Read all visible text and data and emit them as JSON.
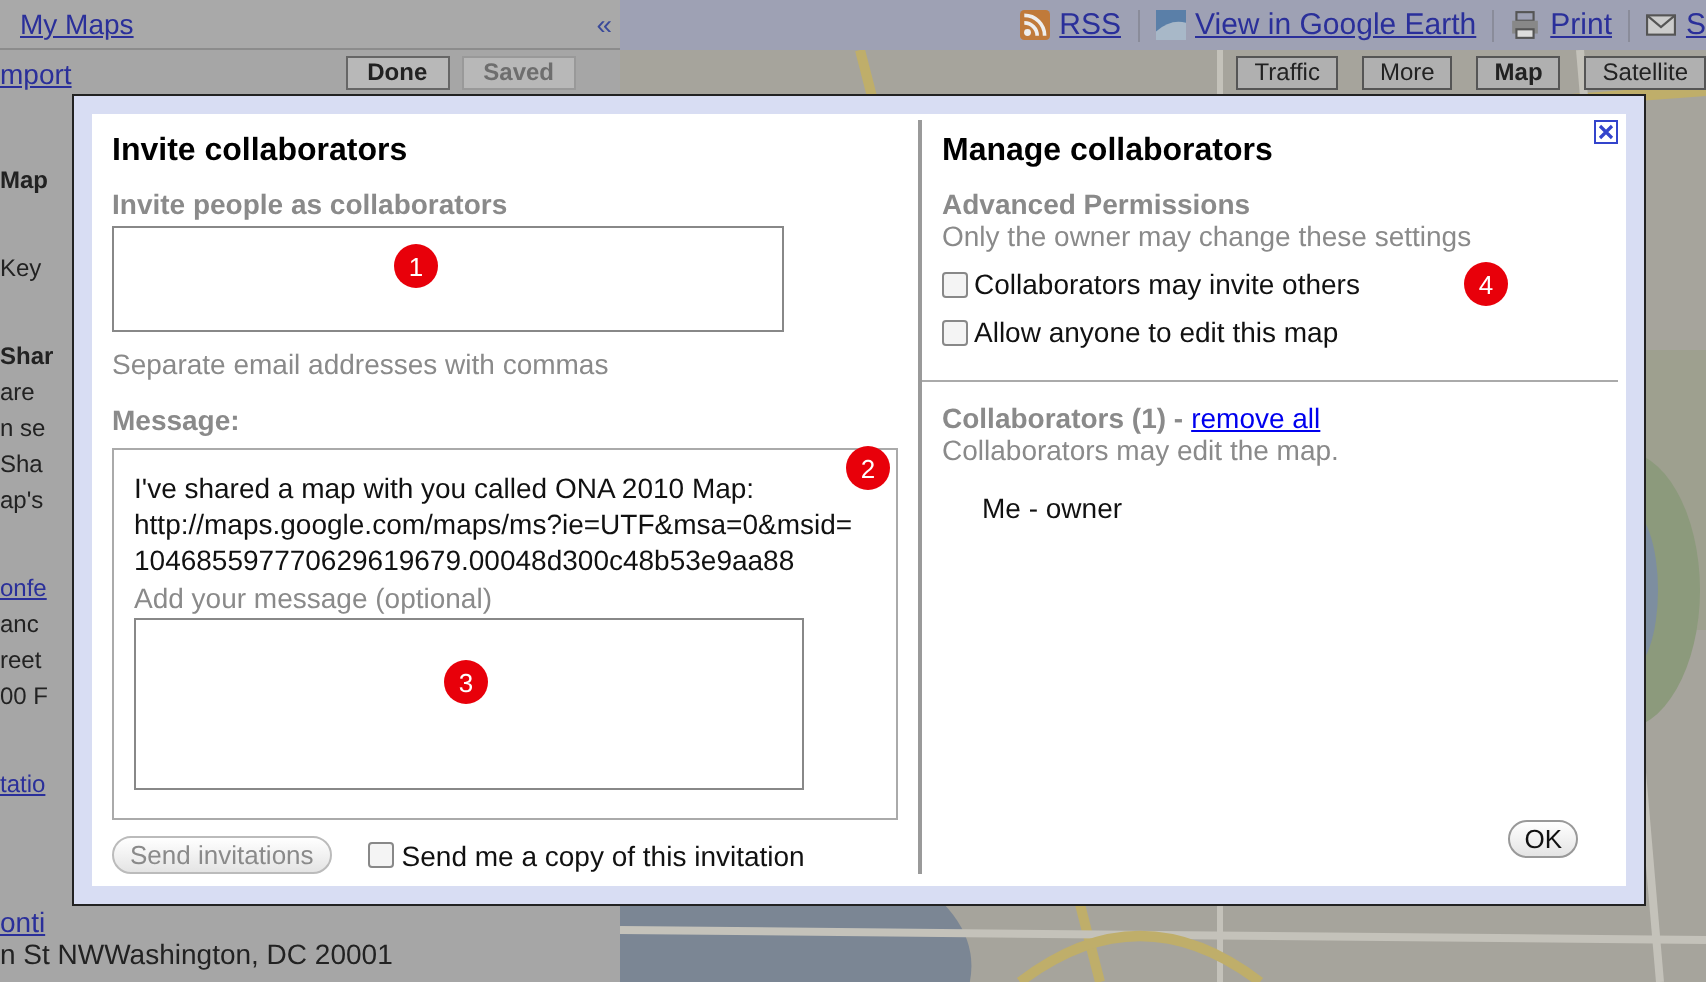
{
  "top_bar": {
    "my_maps": "My Maps",
    "collapse": "«",
    "links": [
      {
        "kind": "rss",
        "label": "RSS"
      },
      {
        "kind": "earth",
        "label": "View in Google Earth"
      },
      {
        "kind": "print",
        "label": "Print"
      },
      {
        "kind": "mail",
        "label": "S"
      }
    ]
  },
  "sidebar": {
    "import_link": "mport",
    "buttons": [
      {
        "label": "Done",
        "disabled": false
      },
      {
        "label": "Saved",
        "disabled": true
      }
    ],
    "blocks": [
      [
        {
          "kind": "heading",
          "text": "Map"
        }
      ],
      [
        {
          "kind": "text",
          "text": "Key"
        }
      ],
      [
        {
          "kind": "heading",
          "text": "Shar"
        },
        {
          "kind": "text",
          "text": "are"
        },
        {
          "kind": "text",
          "text": "n se"
        },
        {
          "kind": "text",
          "text": "Sha"
        },
        {
          "kind": "text",
          "text": "ap's"
        }
      ],
      [
        {
          "kind": "link",
          "text": "onfe"
        },
        {
          "kind": "text",
          "text": "anc"
        },
        {
          "kind": "text",
          "text": "reet"
        },
        {
          "kind": "text",
          "text": "00 F"
        }
      ],
      [
        {
          "kind": "link",
          "text": "tatio"
        }
      ]
    ],
    "address_link": "onti",
    "address": "n St NWWashington, DC 20001"
  },
  "map": {
    "kind": "picture",
    "controls": [
      {
        "label": "Traffic",
        "selected": false
      },
      {
        "label": "More",
        "selected": false
      },
      {
        "label": "Map",
        "selected": true
      },
      {
        "label": "Satellite",
        "selected": false
      }
    ]
  },
  "dialog": {
    "invite": {
      "title": "Invite collaborators",
      "field_label": "Invite people as collaborators",
      "hint": "Separate email addresses with commas",
      "message_label": "Message:",
      "message_lines": [
        "I've shared a map with you called ONA 2010 Map:",
        "http://maps.google.com/maps/ms?ie=UTF&msa=0&msid=",
        "104685597770629619679.00048d300c48b53e9aa88"
      ],
      "optional_label": "Add your message (optional)",
      "send_button": {
        "label": "Send invitations",
        "disabled": true
      },
      "copy_checkbox": {
        "label": "Send me a copy of this invitation",
        "checked": false
      }
    },
    "manage": {
      "title": "Manage collaborators",
      "permissions_heading": "Advanced Permissions",
      "permissions_note": "Only the owner may change these settings",
      "options": [
        {
          "label": "Collaborators may invite others",
          "checked": false
        },
        {
          "label": "Allow anyone to edit this map",
          "checked": false
        }
      ],
      "collaborators_heading": "Collaborators (1) -",
      "remove_all": "remove all",
      "collaborators_note": "Collaborators may edit the map.",
      "members": [
        "Me - owner"
      ],
      "ok_button": "OK"
    }
  },
  "markers": [
    {
      "label": "1"
    },
    {
      "label": "2"
    },
    {
      "label": "3"
    },
    {
      "label": "4"
    }
  ]
}
